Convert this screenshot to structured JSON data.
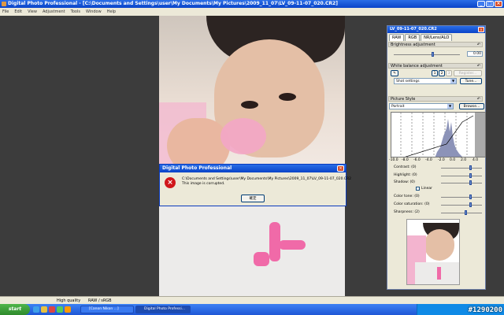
{
  "window": {
    "title": "Digital Photo Professional - [C:\\Documents and Settings\\user\\My Documents\\My Pictures\\2009_11_07\\LV_09-11-07_020.CR2]"
  },
  "menu": [
    "File",
    "Edit",
    "View",
    "Adjustment",
    "Tools",
    "Window",
    "Help"
  ],
  "dialog": {
    "title": "Digital Photo Professional",
    "message_line1": "C:\\Documents and Settings\\user\\My Documents\\My Pictures\\2009_11_07\\LV_09-11-07_020.CR2",
    "message_line2": "This image is corrupted.",
    "ok_label": "確定"
  },
  "panel": {
    "title": "LV_09-11-07_020.CR2",
    "tabs": [
      "RAW",
      "RGB",
      "NR/Lens/ALO"
    ],
    "brightness": {
      "label": "Brightness adjustment",
      "value": "0.00"
    },
    "white_balance": {
      "label": "White balance adjustment",
      "btn1": "1",
      "btn2": "2",
      "btn3": "3",
      "register_label": "Register...",
      "shot_settings": "Shot settings",
      "tune_label": "Tune..."
    },
    "picture_style": {
      "label": "Picture Style",
      "value": "Portrait",
      "browse_label": "Browse..."
    },
    "histogram_ticks": [
      "-10.0",
      "-8.0",
      "-6.0",
      "-4.0",
      "-2.0",
      "0.0",
      "2.0",
      "4.0"
    ],
    "params": {
      "contrast": "Contrast: (0)",
      "highlight": "Highlight: (0)",
      "shadow": "Shadow: (0)",
      "linear": "Linear",
      "color_tone": "Color tone: (0)",
      "color_saturation": "Color saturation: (0)",
      "sharpness": "Sharpness: (2)"
    }
  },
  "status": {
    "quality": "High quality",
    "color_space": "RAW / sRGB"
  },
  "taskbar": {
    "start_label": "start",
    "items": [
      "[Canon Nikon ...]",
      "Digital Photo Professi..."
    ]
  },
  "watermark": "#1290200"
}
